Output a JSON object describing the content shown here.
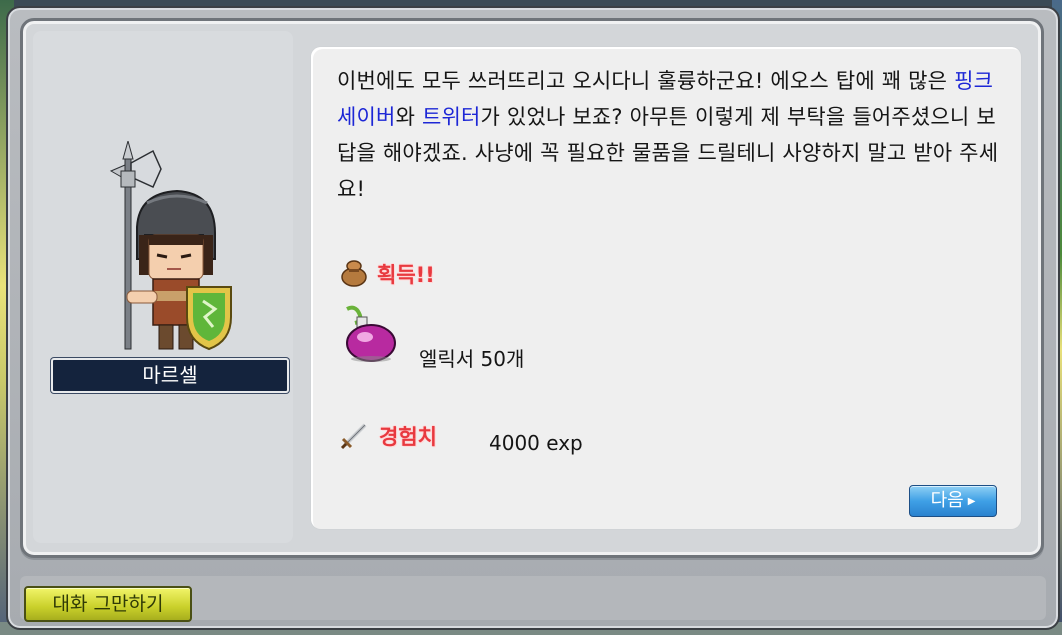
{
  "npc": {
    "name": "마르셀"
  },
  "dialog": {
    "part1": "이번에도 모두 쓰러뜨리고 오시다니 훌륭하군요! 에오스 탑에 꽤 많은 ",
    "monster1": "핑크세이버",
    "part2": "와 ",
    "monster2": "트위터",
    "part3": "가 있었나 보죠? 아무튼 이렇게 제 부탁을 들어주셨으니 보답을 해야겠죠. 사냥에 꼭 필요한 물품을 드릴테니 사양하지 말고 받아 주세요!"
  },
  "rewards": {
    "acquire_label": "획득!!",
    "item_text": "엘릭서 50개",
    "exp_label": "경험치",
    "exp_text": "4000 exp"
  },
  "buttons": {
    "next": "다음",
    "end_chat": "대화 그만하기"
  },
  "icons": {
    "acquire": "bag-icon",
    "item": "elixir-potion-icon",
    "exp": "sword-icon",
    "next_arrow": "triangle-right-icon"
  },
  "colors": {
    "highlight": "#1d27d6",
    "reward_label": "#e8393f",
    "npc_name_bg": "#14233d",
    "next_button": "#3fa0e6",
    "end_button": "#c9d02a"
  }
}
